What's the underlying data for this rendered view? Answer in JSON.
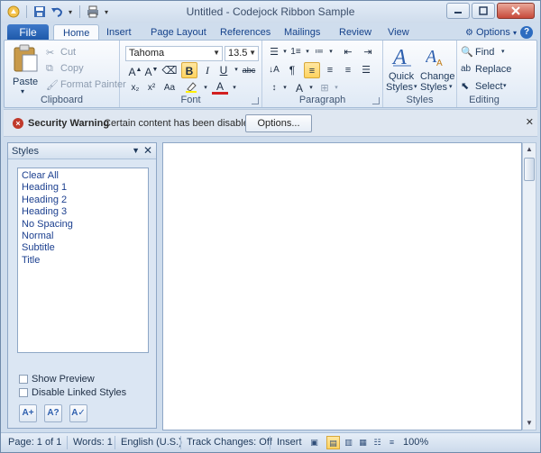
{
  "window": {
    "title": "Untitled - Codejock Ribbon Sample"
  },
  "tabs": {
    "file": "File",
    "items": [
      "Home",
      "Insert",
      "Page Layout",
      "References",
      "Mailings",
      "Review",
      "View"
    ],
    "options": "Options"
  },
  "clipboard": {
    "paste": "Paste",
    "cut": "Cut",
    "copy": "Copy",
    "format_painter": "Format Painter",
    "label": "Clipboard"
  },
  "font": {
    "name": "Tahoma",
    "size": "13.5",
    "label": "Font"
  },
  "paragraph": {
    "label": "Paragraph"
  },
  "styles_group": {
    "quick_styles_1": "Quick",
    "quick_styles_2": "Styles",
    "change_styles_1": "Change",
    "change_styles_2": "Styles",
    "label": "Styles"
  },
  "editing": {
    "find": "Find",
    "replace": "Replace",
    "select": "Select",
    "label": "Editing"
  },
  "security": {
    "title": "Security Warning",
    "message": "Certain content has been disabled.",
    "options_button": "Options..."
  },
  "styles_pane": {
    "title": "Styles",
    "items": [
      "Clear All",
      "Heading 1",
      "Heading 2",
      "Heading 3",
      "No Spacing",
      "Normal",
      "Subtitle",
      "Title"
    ],
    "show_preview": "Show Preview",
    "disable_linked": "Disable Linked Styles"
  },
  "statusbar": {
    "page": "Page: 1 of 1",
    "words": "Words: 1",
    "language": "English (U.S.)",
    "track": "Track Changes: Off",
    "mode": "Insert",
    "zoom": "100%"
  },
  "colors": {
    "accent": "#1b56a7",
    "highlight": "#ffd35f"
  }
}
